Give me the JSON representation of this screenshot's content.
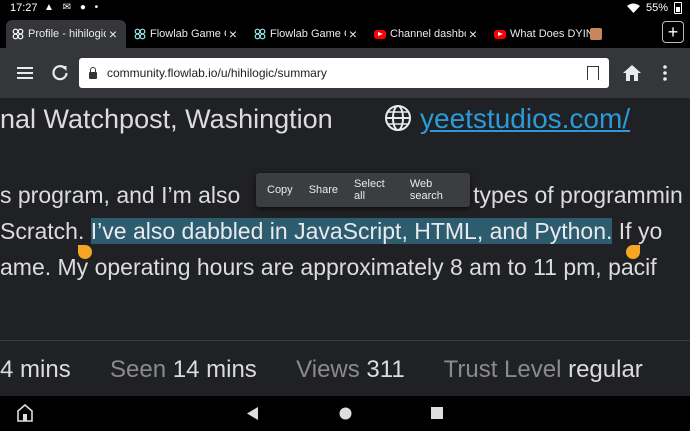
{
  "status_bar": {
    "time": "17:27",
    "icons": "▲ ✉ ● •",
    "battery": "55%"
  },
  "tabs": [
    {
      "title": "Profile - hihilogic",
      "favicon": "flowlab-icon",
      "active": true
    },
    {
      "title": "Flowlab Game Cr",
      "favicon": "flowlab-icon",
      "active": false
    },
    {
      "title": "Flowlab Game Cr",
      "favicon": "flowlab-icon",
      "active": false
    },
    {
      "title": "Channel dashboa",
      "favicon": "youtube-icon",
      "active": false
    },
    {
      "title": "What Does DYIN",
      "favicon": "youtube-icon",
      "active": false
    }
  ],
  "toolbar": {
    "url": "community.flowlab.io/u/hihilogic/summary"
  },
  "profile": {
    "location": "nal Watchpost, Washingtion",
    "website": "yeetstudios.com/",
    "bio_line1_a": "s program, and I’m also ",
    "bio_line1_b": " types of programmin",
    "bio_line2_pre": "Scratch. ",
    "bio_line2_sel": "I’ve also dabbled in JavaScript, HTML, and Python.",
    "bio_line2_post": " If yo",
    "bio_line3": "ame. My operating hours are approximately 8 am to 11 pm, pacif"
  },
  "context_menu": {
    "copy": "Copy",
    "share": "Share",
    "select_all": "Select all",
    "web_search": "Web search"
  },
  "stats": {
    "first_value": "4 mins",
    "seen_label": "Seen",
    "seen_value": "14 mins",
    "views_label": "Views",
    "views_value": "311",
    "trust_label": "Trust Level",
    "trust_value": "regular"
  },
  "colors": {
    "selection": "#2c5c6e",
    "handle": "#f5a623",
    "link": "#2a9bd8"
  }
}
